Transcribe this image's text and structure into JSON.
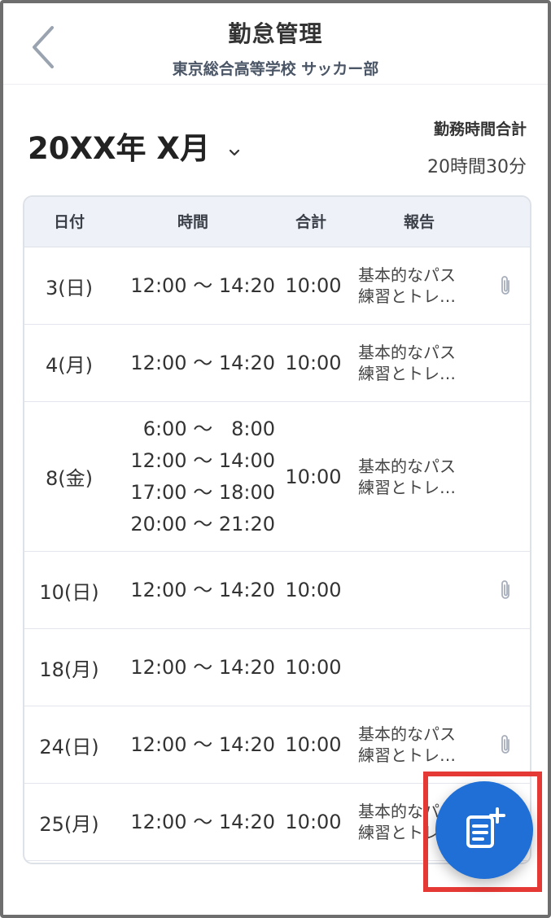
{
  "header": {
    "title": "勤怠管理",
    "subtitle": "東京総合高等学校 サッカー部"
  },
  "month": {
    "label": "20XX年 X月"
  },
  "summary": {
    "label": "勤務時間合計",
    "value": "20時間30分"
  },
  "table": {
    "columns": [
      "日付",
      "時間",
      "合計",
      "報告"
    ],
    "rows": [
      {
        "date": "3(日)",
        "times": [
          "12:00 ～ 14:20"
        ],
        "total": "10:00",
        "report": [
          "基本的なパス",
          "練習とトレ…"
        ],
        "attachment": true
      },
      {
        "date": "4(月)",
        "times": [
          "12:00 ～ 14:20"
        ],
        "total": "10:00",
        "report": [
          "基本的なパス",
          "練習とトレ…"
        ],
        "attachment": false
      },
      {
        "date": "8(金)",
        "times": [
          "6:00 ～   8:00",
          "12:00 ～ 14:00",
          "17:00 ～ 18:00",
          "20:00 ～ 21:20"
        ],
        "total": "10:00",
        "report": [
          "基本的なパス",
          "練習とトレ…"
        ],
        "attachment": false
      },
      {
        "date": "10(日)",
        "times": [
          "12:00 ～ 14:20"
        ],
        "total": "10:00",
        "report": [],
        "attachment": true
      },
      {
        "date": "18(月)",
        "times": [
          "12:00 ～ 14:20"
        ],
        "total": "10:00",
        "report": [],
        "attachment": false
      },
      {
        "date": "24(日)",
        "times": [
          "12:00 ～ 14:20"
        ],
        "total": "10:00",
        "report": [
          "基本的なパス",
          "練習とトレ…"
        ],
        "attachment": true
      },
      {
        "date": "25(月)",
        "times": [
          "12:00 ～ 14:20"
        ],
        "total": "10:00",
        "report": [
          "基本的なパス",
          "練習とトレ…"
        ],
        "attachment": false
      }
    ]
  },
  "icons": {
    "back": "chevron-left-icon",
    "month_dropdown": "chevron-down-icon",
    "attachment": "paperclip-icon",
    "fab": "note-add-icon"
  },
  "colors": {
    "accent": "#1f6fd6",
    "table_header_bg": "#eef1f7",
    "highlight": "#e53935"
  }
}
